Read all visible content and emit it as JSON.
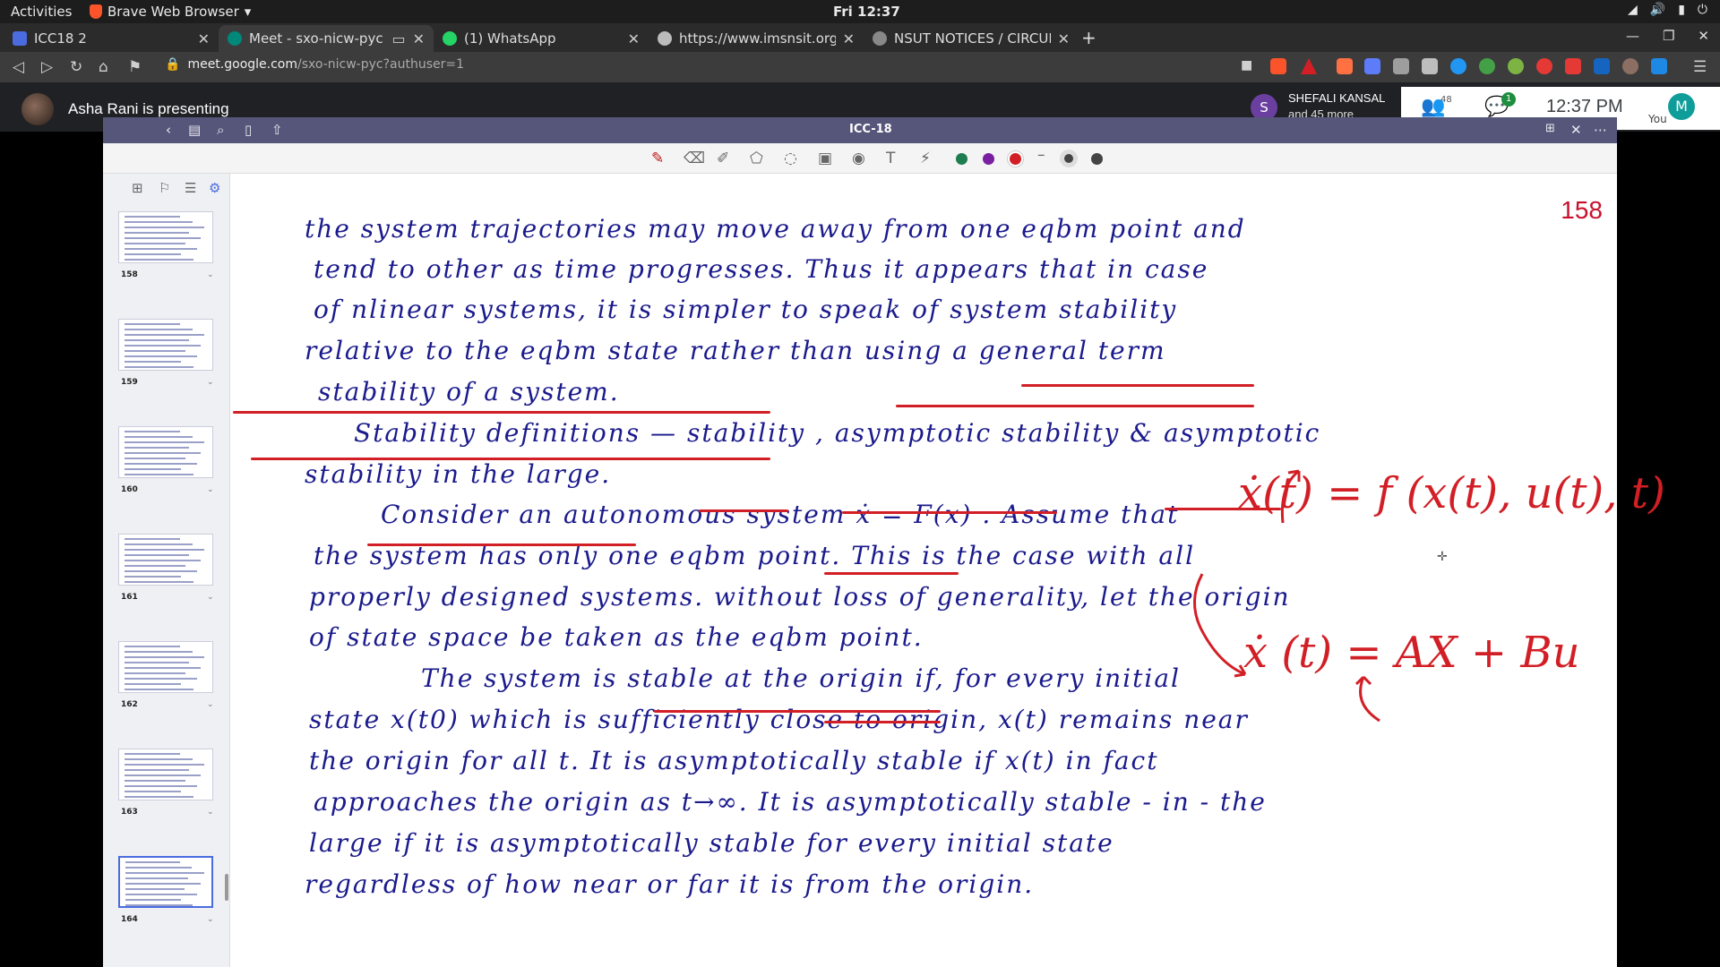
{
  "system": {
    "activities": "Activities",
    "app_name": "Brave Web Browser",
    "clock": "Fri 12:37"
  },
  "browser": {
    "tabs": [
      {
        "title": "ICC18 2",
        "color": "#4a6cdf"
      },
      {
        "title": "Meet - sxo-nicw-pyc",
        "color": "#00897b"
      },
      {
        "title": "(1) WhatsApp",
        "color": "#25d366"
      },
      {
        "title": "https://www.imsnsit.org/i",
        "color": "#bbbbbb"
      },
      {
        "title": "NSUT NOTICES / CIRCULAR",
        "color": "#bbbbbb"
      }
    ],
    "url_host": "meet.google.com",
    "url_path": "/sxo-nicw-pyc?authuser=1"
  },
  "meet": {
    "presenter": "Asha Rani is presenting",
    "participant_initial": "S",
    "participant_name": "SHEFALI KANSAL",
    "participant_more": "and 45 more",
    "people_count": "48",
    "chat_badge": "1",
    "time": "12:37 PM",
    "you_initial": "M",
    "you_label": "You"
  },
  "notes_app": {
    "doc_title": "ICC-18",
    "page_number": "158",
    "pen_colors": [
      "#1e7d4f",
      "#7b1fa2",
      "#d21f26"
    ],
    "thumbnails": [
      {
        "label": "158"
      },
      {
        "label": "159"
      },
      {
        "label": "160"
      },
      {
        "label": "161"
      },
      {
        "label": "162"
      },
      {
        "label": "163"
      },
      {
        "label": "164"
      }
    ],
    "lines": [
      "the system trajectories may move away from one eqbm point and",
      "tend to other as time progresses. Thus it appears that in case",
      "of nlinear systems, it is simpler to speak of system stability",
      "relative to the eqbm state rather than using a general term",
      "stability of a system.",
      "Stability definitions — stability , asymptotic stability & asymptotic",
      "stability in the large.",
      "Consider an autonomous system ẋ = F(x) . Assume that",
      "the system has only one eqbm point. This is the case with all",
      "properly designed systems. without loss of generality, let the origin",
      "of state space be taken as the eqbm point.",
      "The system is stable at the origin if, for every initial",
      "state x(t0) which is sufficiently close to origin, x(t) remains near",
      "the origin for all t. It is asymptotically stable if x(t) in fact",
      "approaches the origin as t→∞. It is asymptotically stable - in - the",
      "large if it is asymptotically stable for every initial state",
      "regardless of how near or far it is from the origin."
    ],
    "annotations": {
      "eq1": "ẋ(t) = f (x(t), u(t), t)",
      "eq2": "ẋ (t) = AX + Bu"
    }
  }
}
